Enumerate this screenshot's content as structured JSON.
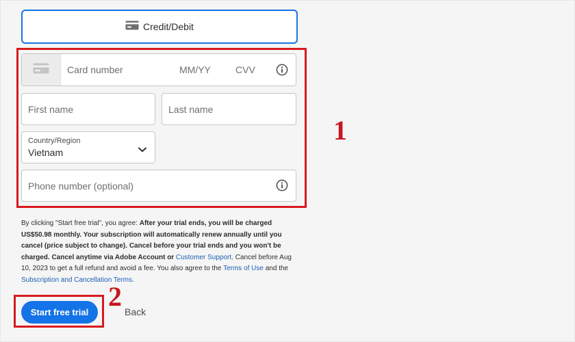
{
  "payment_method": {
    "label": "Credit/Debit",
    "icon": "credit-card-icon"
  },
  "card": {
    "number_placeholder": "Card number",
    "expiry_placeholder": "MM/YY",
    "cvv_placeholder": "CVV"
  },
  "name": {
    "first_placeholder": "First name",
    "last_placeholder": "Last name"
  },
  "country": {
    "label": "Country/Region",
    "value": "Vietnam"
  },
  "phone": {
    "placeholder": "Phone number (optional)"
  },
  "terms": {
    "t1": "By clicking \"Start free trial\", you agree: ",
    "t2_bold": "After your trial ends, you will be charged US$50.98 monthly. Your subscription will automatically renew annually until you cancel (price subject to change). Cancel before your trial ends and you won't be charged. Cancel anytime via Adobe Account or ",
    "link_support": "Customer Support",
    "t3": ". Cancel before Aug 10, 2023 to get a full refund and avoid a fee. You also agree to the ",
    "link_terms_of_use": "Terms of Use",
    "t4": " and the ",
    "link_subscription_terms": "Subscription and Cancellation Terms",
    "t5": "."
  },
  "actions": {
    "start_label": "Start free trial",
    "back_label": "Back"
  },
  "annotations": {
    "one": "1",
    "two": "2"
  },
  "colors": {
    "accent": "#1473e6",
    "annotation": "#d7191e"
  }
}
